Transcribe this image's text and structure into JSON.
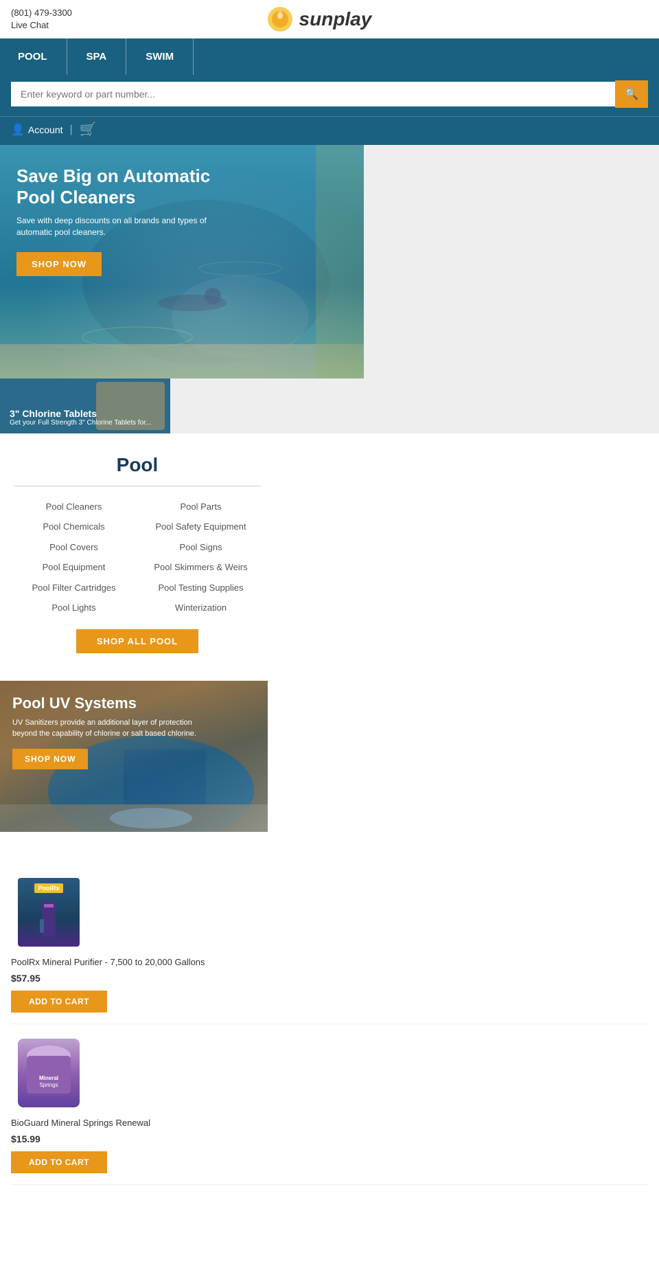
{
  "site": {
    "name": "sunplay",
    "logo_text": "sunplay"
  },
  "topbar": {
    "phone": "(801) 479-3300",
    "live_chat": "Live Chat"
  },
  "nav": {
    "items": [
      {
        "label": "POOL",
        "id": "pool"
      },
      {
        "label": "SPA",
        "id": "spa"
      },
      {
        "label": "SWIM",
        "id": "swim"
      }
    ]
  },
  "search": {
    "placeholder": "Enter keyword or part number..."
  },
  "account": {
    "label": "Account",
    "divider": "|"
  },
  "hero": {
    "title": "Save Big on Automatic Pool Cleaners",
    "subtitle": "Save with deep discounts on all brands and types of automatic pool cleaners.",
    "cta": "SHOP NOW"
  },
  "chlorine_banner": {
    "title": "3\" Chlorine Tablets",
    "subtitle": "Get your Full Strength 3\" Chlorine Tablets for..."
  },
  "pool_section": {
    "title": "Pool",
    "links": [
      {
        "label": "Pool Cleaners"
      },
      {
        "label": "Pool Parts"
      },
      {
        "label": "Pool Chemicals"
      },
      {
        "label": "Pool Safety Equipment"
      },
      {
        "label": "Pool Covers"
      },
      {
        "label": "Pool Signs"
      },
      {
        "label": "Pool Equipment"
      },
      {
        "label": "Pool Skimmers & Weirs"
      },
      {
        "label": "Pool Filter Cartridges"
      },
      {
        "label": "Pool Testing Supplies"
      },
      {
        "label": "Pool Lights"
      },
      {
        "label": "Winterization"
      }
    ],
    "shop_all_label": "SHOP ALL POOL"
  },
  "uv_banner": {
    "title": "Pool UV Systems",
    "subtitle": "UV Sanitizers provide an additional layer of protection beyond the capability of chlorine or salt based chlorine.",
    "cta": "SHOP NOW"
  },
  "products": [
    {
      "id": "poolrx",
      "name": "PoolRx Mineral Purifier - 7,500 to 20,000 Gallons",
      "price": "$57.95",
      "add_to_cart_label": "ADD TO CART"
    },
    {
      "id": "bioguard",
      "name": "BioGuard Mineral Springs Renewal",
      "price": "$15.99",
      "add_to_cart_label": "ADD TO CART"
    }
  ],
  "colors": {
    "nav_bg": "#1a6080",
    "accent": "#e8971a",
    "text_dark": "#1a3a5c"
  }
}
